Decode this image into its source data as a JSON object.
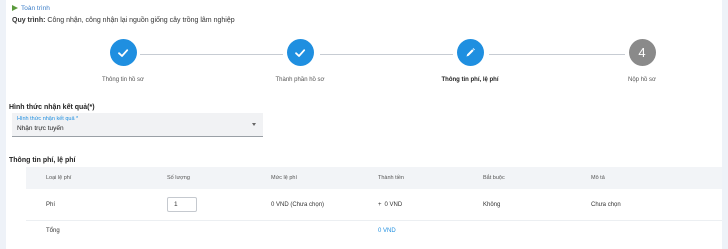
{
  "breadcrumb": "Toàn trình",
  "procedure": {
    "label": "Quy trình:",
    "value": "Công nhận, công nhận lại nguồn giống cây trồng lâm nghiệp"
  },
  "steps": [
    {
      "label": "Thông tin hồ sơ",
      "state": "done",
      "icon": "check-icon"
    },
    {
      "label": "Thành phần hồ sơ",
      "state": "done",
      "icon": "check-icon"
    },
    {
      "label": "Thông tin phí, lệ phí",
      "state": "active",
      "icon": "pencil-icon"
    },
    {
      "label": "Nộp hồ sơ",
      "state": "pending",
      "number": "4"
    }
  ],
  "result_section": {
    "title": "Hình thức nhận kết quả(*)",
    "field_label": "Hình thức nhận kết quả *",
    "field_value": "Nhận trực tuyến"
  },
  "fee_section": {
    "title": "Thông tin phí, lệ phí",
    "headers": [
      "Loại lệ phí",
      "Số lượng",
      "Mức lệ phí",
      "Thành tiền",
      "Bắt buộc",
      "Mô tả"
    ],
    "rows": [
      {
        "type": "Phí",
        "quantity": "1",
        "fee": "0 VND (Chưa chọn)",
        "amount": "0 VND",
        "required": "Không",
        "description": "Chưa chọn"
      }
    ],
    "total_label": "Tổng",
    "total_value": "0 VND"
  },
  "colors": {
    "accent": "#1f8fe0",
    "pending": "#8a8a8a",
    "breadcrumb_arrow": "#5b9a3c"
  }
}
